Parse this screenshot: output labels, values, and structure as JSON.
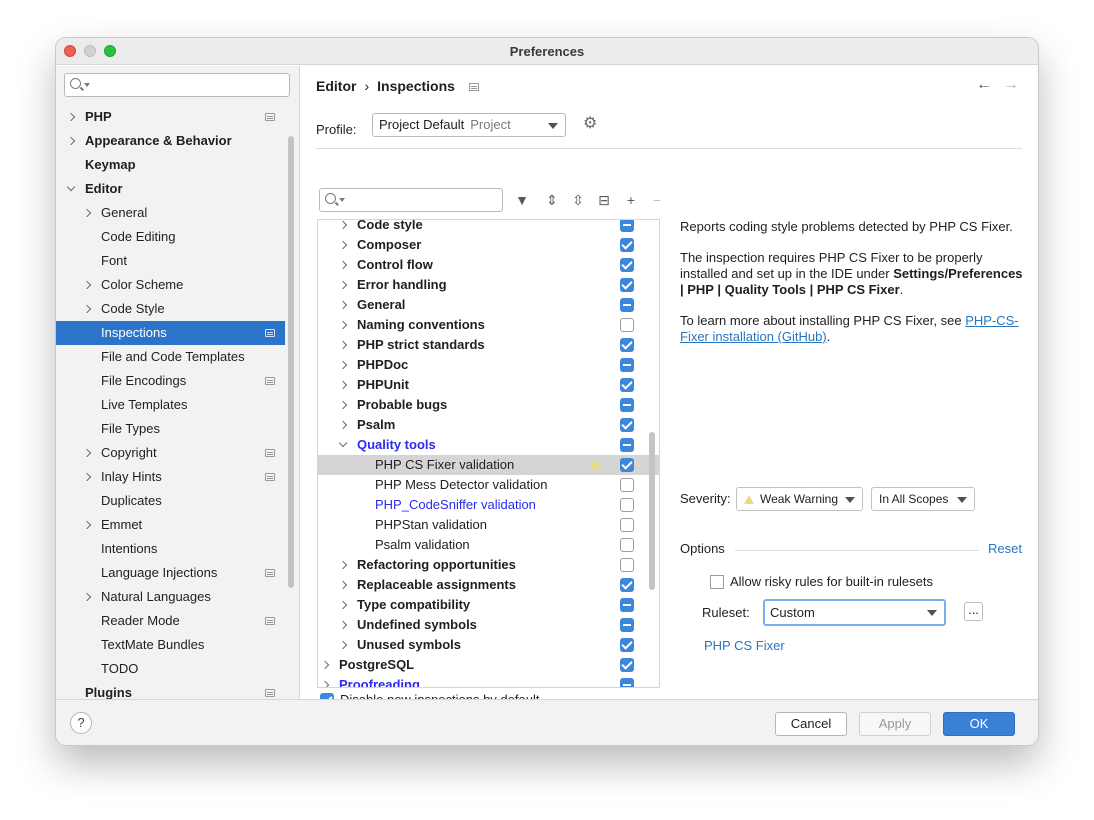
{
  "window": {
    "title": "Preferences"
  },
  "sidebar": {
    "items": [
      {
        "label": "PHP",
        "expand": "right",
        "bold": true,
        "proj": true
      },
      {
        "label": "Appearance & Behavior",
        "expand": "right",
        "bold": true,
        "proj": false
      },
      {
        "label": "Keymap",
        "expand": "",
        "bold": true,
        "proj": false
      },
      {
        "label": "Editor",
        "expand": "down",
        "bold": true,
        "proj": false
      },
      {
        "label": "General",
        "expand": "right",
        "bold": false,
        "proj": false
      },
      {
        "label": "Code Editing",
        "expand": "",
        "bold": false,
        "proj": false
      },
      {
        "label": "Font",
        "expand": "",
        "bold": false,
        "proj": false
      },
      {
        "label": "Color Scheme",
        "expand": "right",
        "bold": false,
        "proj": false
      },
      {
        "label": "Code Style",
        "expand": "right",
        "bold": false,
        "proj": false
      },
      {
        "label": "Inspections",
        "expand": "",
        "bold": false,
        "proj": true,
        "selected": true
      },
      {
        "label": "File and Code Templates",
        "expand": "",
        "bold": false,
        "proj": false
      },
      {
        "label": "File Encodings",
        "expand": "",
        "bold": false,
        "proj": true
      },
      {
        "label": "Live Templates",
        "expand": "",
        "bold": false,
        "proj": false
      },
      {
        "label": "File Types",
        "expand": "",
        "bold": false,
        "proj": false
      },
      {
        "label": "Copyright",
        "expand": "right",
        "bold": false,
        "proj": true
      },
      {
        "label": "Inlay Hints",
        "expand": "right",
        "bold": false,
        "proj": true
      },
      {
        "label": "Duplicates",
        "expand": "",
        "bold": false,
        "proj": false
      },
      {
        "label": "Emmet",
        "expand": "right",
        "bold": false,
        "proj": false
      },
      {
        "label": "Intentions",
        "expand": "",
        "bold": false,
        "proj": false
      },
      {
        "label": "Language Injections",
        "expand": "",
        "bold": false,
        "proj": true
      },
      {
        "label": "Natural Languages",
        "expand": "right",
        "bold": false,
        "proj": false
      },
      {
        "label": "Reader Mode",
        "expand": "",
        "bold": false,
        "proj": true
      },
      {
        "label": "TextMate Bundles",
        "expand": "",
        "bold": false,
        "proj": false
      },
      {
        "label": "TODO",
        "expand": "",
        "bold": false,
        "proj": false
      },
      {
        "label": "Plugins",
        "expand": "",
        "bold": true,
        "proj": true
      }
    ]
  },
  "breadcrumb": {
    "parent": "Editor",
    "separator": "›",
    "current": "Inspections"
  },
  "profile": {
    "label": "Profile:",
    "value": "Project Default",
    "scope": "Project"
  },
  "tree": {
    "rows": [
      {
        "label": "Code style",
        "level": 1,
        "expand": "right",
        "bold": true,
        "cb": "mixed"
      },
      {
        "label": "Composer",
        "level": 1,
        "expand": "right",
        "bold": true,
        "cb": "checked"
      },
      {
        "label": "Control flow",
        "level": 1,
        "expand": "right",
        "bold": true,
        "cb": "checked"
      },
      {
        "label": "Error handling",
        "level": 1,
        "expand": "right",
        "bold": true,
        "cb": "checked"
      },
      {
        "label": "General",
        "level": 1,
        "expand": "right",
        "bold": true,
        "cb": "mixed"
      },
      {
        "label": "Naming conventions",
        "level": 1,
        "expand": "right",
        "bold": true,
        "cb": "empty"
      },
      {
        "label": "PHP strict standards",
        "level": 1,
        "expand": "right",
        "bold": true,
        "cb": "checked"
      },
      {
        "label": "PHPDoc",
        "level": 1,
        "expand": "right",
        "bold": true,
        "cb": "mixed"
      },
      {
        "label": "PHPUnit",
        "level": 1,
        "expand": "right",
        "bold": true,
        "cb": "checked"
      },
      {
        "label": "Probable bugs",
        "level": 1,
        "expand": "right",
        "bold": true,
        "cb": "mixed"
      },
      {
        "label": "Psalm",
        "level": 1,
        "expand": "right",
        "bold": true,
        "cb": "checked"
      },
      {
        "label": "Quality tools",
        "level": 1,
        "expand": "down",
        "bold": true,
        "link": true,
        "cb": "mixed"
      },
      {
        "label": "PHP CS Fixer validation",
        "level": 2,
        "expand": "",
        "bold": false,
        "cb": "checked",
        "selected": true,
        "warn": true
      },
      {
        "label": "PHP Mess Detector validation",
        "level": 2,
        "expand": "",
        "bold": false,
        "cb": "empty"
      },
      {
        "label": "PHP_CodeSniffer validation",
        "level": 2,
        "expand": "",
        "bold": false,
        "link": true,
        "cb": "empty"
      },
      {
        "label": "PHPStan validation",
        "level": 2,
        "expand": "",
        "bold": false,
        "cb": "empty"
      },
      {
        "label": "Psalm validation",
        "level": 2,
        "expand": "",
        "bold": false,
        "cb": "empty"
      },
      {
        "label": "Refactoring opportunities",
        "level": 1,
        "expand": "right",
        "bold": true,
        "cb": "empty"
      },
      {
        "label": "Replaceable assignments",
        "level": 1,
        "expand": "right",
        "bold": true,
        "cb": "checked"
      },
      {
        "label": "Type compatibility",
        "level": 1,
        "expand": "right",
        "bold": true,
        "cb": "mixed"
      },
      {
        "label": "Undefined symbols",
        "level": 1,
        "expand": "right",
        "bold": true,
        "cb": "mixed"
      },
      {
        "label": "Unused symbols",
        "level": 1,
        "expand": "right",
        "bold": true,
        "cb": "checked"
      },
      {
        "label": "PostgreSQL",
        "level": 0,
        "expand": "right",
        "bold": true,
        "cb": "checked"
      },
      {
        "label": "Proofreading",
        "level": 0,
        "expand": "right",
        "bold": true,
        "link": true,
        "cb": "mixed"
      }
    ]
  },
  "disable_new": {
    "label": "Disable new inspections by default",
    "checked": true
  },
  "description": {
    "p1": "Reports coding style problems detected by PHP CS Fixer.",
    "p2_a": "The inspection requires PHP CS Fixer to be properly installed and set up in the IDE under ",
    "p2_bold": "Settings/Preferences | PHP | Quality Tools | PHP CS Fixer",
    "p2_end": ".",
    "p3_a": "To learn more about installing PHP CS Fixer, see ",
    "p3_link": "PHP-CS-Fixer installation (GitHub)",
    "p3_end": "."
  },
  "severity": {
    "label": "Severity:",
    "value": "Weak Warning",
    "scope": "In All Scopes"
  },
  "options": {
    "label": "Options",
    "reset": "Reset",
    "risky_label": "Allow risky rules for built-in rulesets",
    "risky_checked": false,
    "ruleset_label": "Ruleset:",
    "ruleset_value": "Custom",
    "ellipsis": "...",
    "link": "PHP CS Fixer"
  },
  "footer": {
    "help": "?",
    "cancel": "Cancel",
    "apply": "Apply",
    "ok": "OK"
  }
}
